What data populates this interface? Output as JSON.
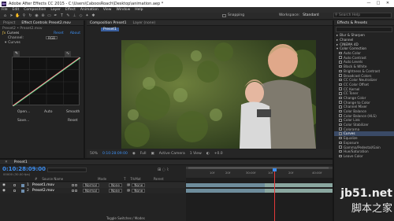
{
  "window": {
    "title": "Adobe After Effects CC 2015 - C:\\Users\\CaboosRoach\\Desktop\\animation.aep *",
    "app_icon": "Ae",
    "minimize": "—",
    "maximize": "□",
    "close": "✕"
  },
  "menu": [
    "File",
    "Edit",
    "Composition",
    "Layer",
    "Effect",
    "Animation",
    "View",
    "Window",
    "Help"
  ],
  "toolbar": {
    "snapping_label": "Snapping",
    "workspace_label": "Workspace:",
    "workspace_value": "Standard",
    "search_placeholder": "Search Help"
  },
  "left_panel": {
    "tabs": [
      "Project",
      "Effect Controls Preset2.mov"
    ],
    "breadcrumb": "Preset2 • Preset2.mov",
    "effect": {
      "name": "Curves",
      "reset": "Reset",
      "about": "About"
    },
    "channel_label": "Channel:",
    "channel_value": "RGB",
    "curves_label": "Curves",
    "buttons": [
      "Open...",
      "Auto",
      "Smooth",
      "Save...",
      "Reset"
    ]
  },
  "comp_panel": {
    "tabs": [
      "Composition Preset1",
      "Layer (none)"
    ],
    "subtab": "Preset1",
    "footer": {
      "zoom": "50%",
      "timecode": "0:10:28:09:00",
      "quality": "Full",
      "camera": "Active Camera",
      "views": "1 View",
      "offset": "+0.0"
    }
  },
  "right_panel": {
    "title": "Effects & Presets",
    "search_value": "",
    "categories_top": [
      "Blur & Sharpen",
      "Channel",
      "CINEMA 4D",
      "Color Correction"
    ],
    "items": [
      "Auto Color",
      "Auto Contrast",
      "Auto Levels",
      "Black & White",
      "Brightness & Contrast",
      "Broadcast Colors",
      "CC Color Neutralizer",
      "CC Color Offset",
      "CC Kernel",
      "CC Toner",
      "Change Color",
      "Change to Color",
      "Channel Mixer",
      "Color Balance",
      "Color Balance (HLS)",
      "Color Link",
      "Color Stabilizer",
      "Colorama",
      "Curves",
      "Equalize",
      "Exposure",
      "Gamma/Pedestal/Gain",
      "Hue/Saturation",
      "Leave Color"
    ],
    "highlighted_item": "Curves"
  },
  "timeline": {
    "tab": "Preset1",
    "current_time": "0:10:28:09:00",
    "frame_info": "00000 (30.00 fps)",
    "columns": [
      "#",
      "Source Name",
      "Mode",
      "T",
      "TrkMat",
      "Parent"
    ],
    "layers": [
      {
        "num": "1",
        "name": "Preset1.mov",
        "mode": "Normal",
        "trkmat": "None",
        "parent": "None",
        "color": "#6f8fb0"
      },
      {
        "num": "2",
        "name": "Preset2.mov",
        "mode": "Normal",
        "trkmat": "None",
        "parent": "None",
        "color": "#6f8fb0"
      }
    ],
    "ruler_labels": [
      "10f",
      "20f",
      "30:00f",
      "10f",
      "20f",
      "40:00f"
    ],
    "bottom_label": "Toggle Switches / Modes"
  },
  "watermark": {
    "line1": "jb51.net",
    "line2": "脚本之家"
  },
  "colors": {
    "accent_blue": "#3d8ef0",
    "track_bar": "#8aa7a0",
    "playhead": "#e33a3a"
  }
}
